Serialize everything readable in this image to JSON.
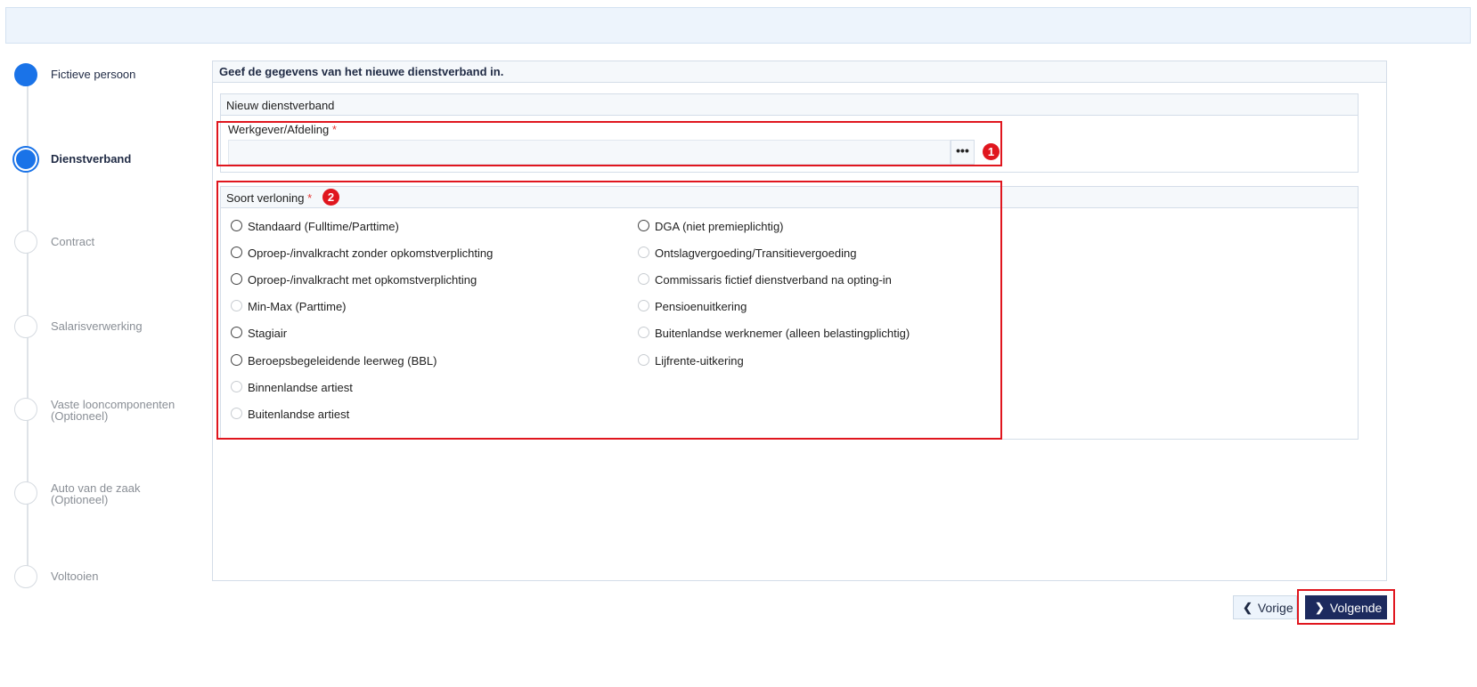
{
  "steps": [
    {
      "label": "Fictieve persoon",
      "state": "done"
    },
    {
      "label": "Dienstverband",
      "state": "current"
    },
    {
      "label": "Contract",
      "state": "todo"
    },
    {
      "label": "Salarisverwerking",
      "state": "todo"
    },
    {
      "label": "Vaste looncomponenten",
      "sub": "(Optioneel)",
      "state": "todo"
    },
    {
      "label": "Auto van de zaak",
      "sub": "(Optioneel)",
      "state": "todo"
    },
    {
      "label": "Voltooien",
      "state": "todo"
    }
  ],
  "panel": {
    "title": "Geef de gegevens van het nieuwe dienstverband in.",
    "section1": {
      "title": "Nieuw dienstverband",
      "field_label": "Werkgever/Afdeling",
      "required_mark": "*",
      "lookup_button": "•••",
      "value": ""
    },
    "section2": {
      "title": "Soort verloning",
      "required_mark": "*",
      "options_left": [
        {
          "label": "Standaard (Fulltime/Parttime)",
          "enabled": true
        },
        {
          "label": "Oproep-/invalkracht zonder opkomstverplichting",
          "enabled": true
        },
        {
          "label": "Oproep-/invalkracht met opkomstverplichting",
          "enabled": true
        },
        {
          "label": "Min-Max (Parttime)",
          "enabled": false
        },
        {
          "label": "Stagiair",
          "enabled": true
        },
        {
          "label": "Beroepsbegeleidende leerweg (BBL)",
          "enabled": true
        },
        {
          "label": "Binnenlandse artiest",
          "enabled": false
        },
        {
          "label": "Buitenlandse artiest",
          "enabled": false
        }
      ],
      "options_right": [
        {
          "label": "DGA (niet premieplichtig)",
          "enabled": true
        },
        {
          "label": "Ontslagvergoeding/Transitievergoeding",
          "enabled": false
        },
        {
          "label": "Commissaris fictief dienstverband na opting-in",
          "enabled": false
        },
        {
          "label": "Pensioenuitkering",
          "enabled": false
        },
        {
          "label": "Buitenlandse werknemer (alleen belastingplichtig)",
          "enabled": false
        },
        {
          "label": "Lijfrente-uitkering",
          "enabled": false
        }
      ]
    }
  },
  "annotations": {
    "badge1": "1",
    "badge2": "2"
  },
  "buttons": {
    "prev_label": "Vorige",
    "next_label": "Volgende"
  },
  "colors": {
    "accent": "#1a73e8",
    "primary_button": "#1c2a5e",
    "highlight": "#e0161e"
  }
}
